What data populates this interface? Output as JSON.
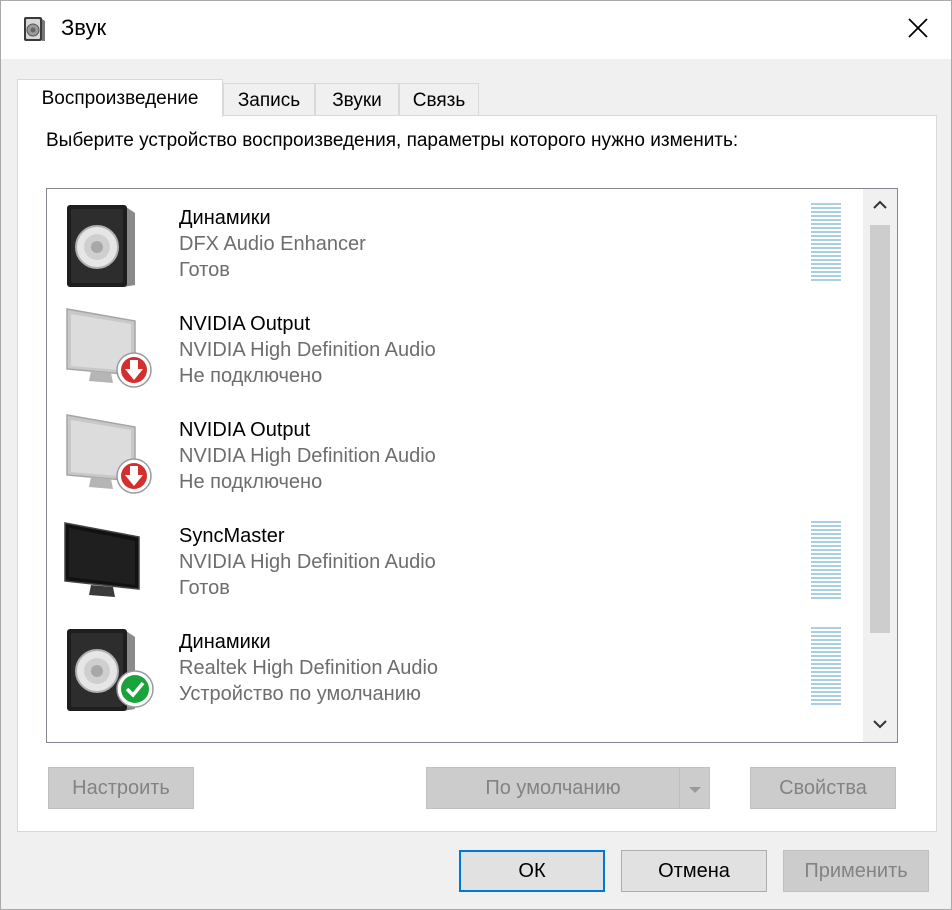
{
  "window": {
    "title": "Звук",
    "icon": "speaker-icon",
    "close_icon": "close-icon"
  },
  "tabs": [
    {
      "label": "Воспроизведение",
      "active": true
    },
    {
      "label": "Запись",
      "active": false
    },
    {
      "label": "Звуки",
      "active": false
    },
    {
      "label": "Связь",
      "active": false
    }
  ],
  "panel": {
    "instruction": "Выберите устройство воспроизведения, параметры которого нужно изменить:"
  },
  "devices": [
    {
      "name": "Динамики",
      "description": "DFX Audio Enhancer",
      "status": "Готов",
      "icon": "speaker-icon",
      "badge": "none",
      "level_meter": true
    },
    {
      "name": "NVIDIA Output",
      "description": "NVIDIA High Definition Audio",
      "status": "Не подключено",
      "icon": "monitor-icon",
      "badge": "disconnected-arrow-icon",
      "level_meter": false
    },
    {
      "name": "NVIDIA Output",
      "description": "NVIDIA High Definition Audio",
      "status": "Не подключено",
      "icon": "monitor-icon",
      "badge": "disconnected-arrow-icon",
      "level_meter": false
    },
    {
      "name": "SyncMaster",
      "description": "NVIDIA High Definition Audio",
      "status": "Готов",
      "icon": "monitor-icon",
      "badge": "none",
      "level_meter": true
    },
    {
      "name": "Динамики",
      "description": "Realtek High Definition Audio",
      "status": "Устройство по умолчанию",
      "icon": "speaker-icon",
      "badge": "default-check-icon",
      "level_meter": true
    }
  ],
  "panel_buttons": {
    "configure": "Настроить",
    "set_default": "По умолчанию",
    "properties": "Свойства"
  },
  "dialog_buttons": {
    "ok": "ОК",
    "cancel": "Отмена",
    "apply": "Применить"
  },
  "colors": {
    "default_button_border": "#0078d7",
    "disconnected_badge": "#d32f2f",
    "default_badge": "#1aa33a",
    "level_meter": "#a9cfe0"
  }
}
